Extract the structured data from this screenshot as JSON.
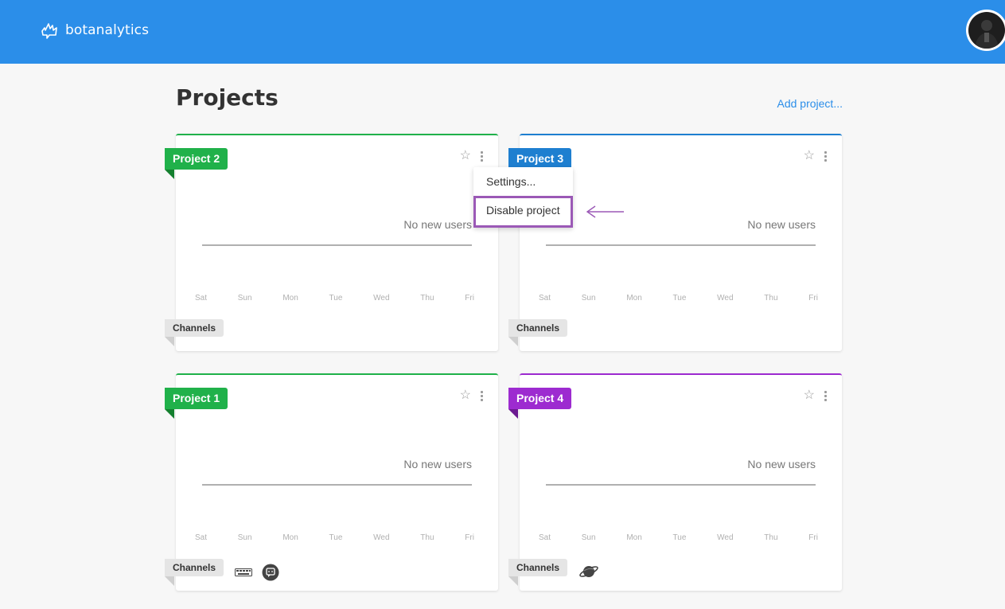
{
  "app": {
    "name": "botanalytics"
  },
  "page": {
    "title": "Projects",
    "add_project": "Add project..."
  },
  "days": [
    "Sat",
    "Sun",
    "Mon",
    "Tue",
    "Wed",
    "Thu",
    "Fri"
  ],
  "projects": [
    {
      "name": "Project 2",
      "status": "No new users",
      "color": "#20b14a",
      "channels_label": "Channels",
      "channel_icons": []
    },
    {
      "name": "Project 3",
      "status": "No new users",
      "color": "#1e7fd0",
      "channels_label": "Channels",
      "channel_icons": []
    },
    {
      "name": "Project 1",
      "status": "No new users",
      "color": "#20b14a",
      "channels_label": "Channels",
      "channel_icons": [
        "keyboard-icon",
        "chat-bubble-icon"
      ]
    },
    {
      "name": "Project 4",
      "status": "No new users",
      "color": "#9d2bd0",
      "channels_label": "Channels",
      "channel_icons": [
        "planet-icon"
      ]
    }
  ],
  "menu": {
    "items": [
      "Settings...",
      "Disable project"
    ]
  },
  "colors": {
    "header": "#2b8ee9",
    "highlight": "#9b59b6"
  }
}
